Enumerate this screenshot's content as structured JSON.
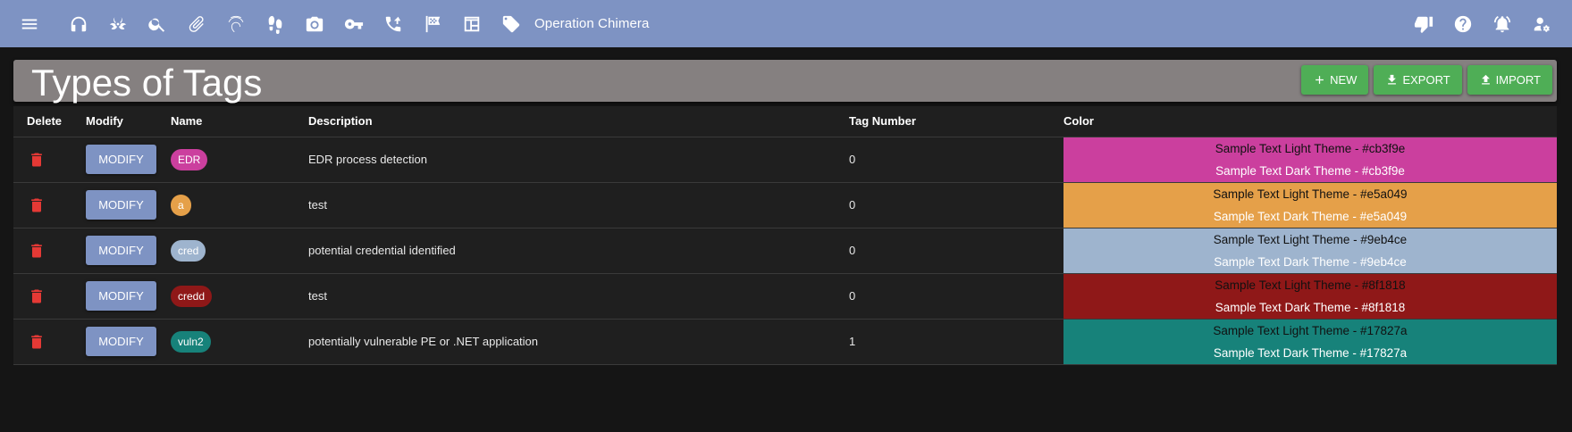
{
  "topbar": {
    "project_name": "Operation Chimera",
    "left_icons": [
      "menu-icon",
      "headphones-icon",
      "biohazard-icon",
      "search-icon",
      "paperclip-icon",
      "fingerprint-icon",
      "footprints-icon",
      "camera-icon",
      "key-icon",
      "phone-callback-icon",
      "flag-checkered-icon",
      "table-icon",
      "tag-icon"
    ],
    "right_icons": [
      "thumb-down-icon",
      "help-icon",
      "bell-alert-icon",
      "user-settings-icon"
    ]
  },
  "header": {
    "title": "Types of Tags",
    "new_label": "NEW",
    "export_label": "EXPORT",
    "import_label": "IMPORT"
  },
  "table": {
    "columns": [
      "Delete",
      "Modify",
      "Name",
      "Description",
      "Tag Number",
      "Color"
    ],
    "modify_label": "MODIFY",
    "rows": [
      {
        "name": "EDR",
        "description": "EDR process detection",
        "tag_number": "0",
        "color": "#cb3f9e",
        "light_text": "Sample Text Light Theme - #cb3f9e",
        "dark_text": "Sample Text Dark Theme - #cb3f9e"
      },
      {
        "name": "a",
        "description": "test",
        "tag_number": "0",
        "color": "#e5a049",
        "light_text": "Sample Text Light Theme - #e5a049",
        "dark_text": "Sample Text Dark Theme - #e5a049"
      },
      {
        "name": "cred",
        "description": "potential credential identified",
        "tag_number": "0",
        "color": "#9eb4ce",
        "light_text": "Sample Text Light Theme - #9eb4ce",
        "dark_text": "Sample Text Dark Theme - #9eb4ce"
      },
      {
        "name": "credd",
        "description": "test",
        "tag_number": "0",
        "color": "#8f1818",
        "light_text": "Sample Text Light Theme - #8f1818",
        "dark_text": "Sample Text Dark Theme - #8f1818"
      },
      {
        "name": "vuln2",
        "description": "potentially vulnerable PE or .NET application",
        "tag_number": "1",
        "color": "#17827a",
        "light_text": "Sample Text Light Theme - #17827a",
        "dark_text": "Sample Text Dark Theme - #17827a"
      }
    ]
  },
  "colors": {
    "topbar": "#7e93c3",
    "header_panel": "#858080",
    "action_button": "#4fae56",
    "modify_button": "#7e93c3",
    "delete_icon": "#e53935",
    "background": "#151515"
  }
}
